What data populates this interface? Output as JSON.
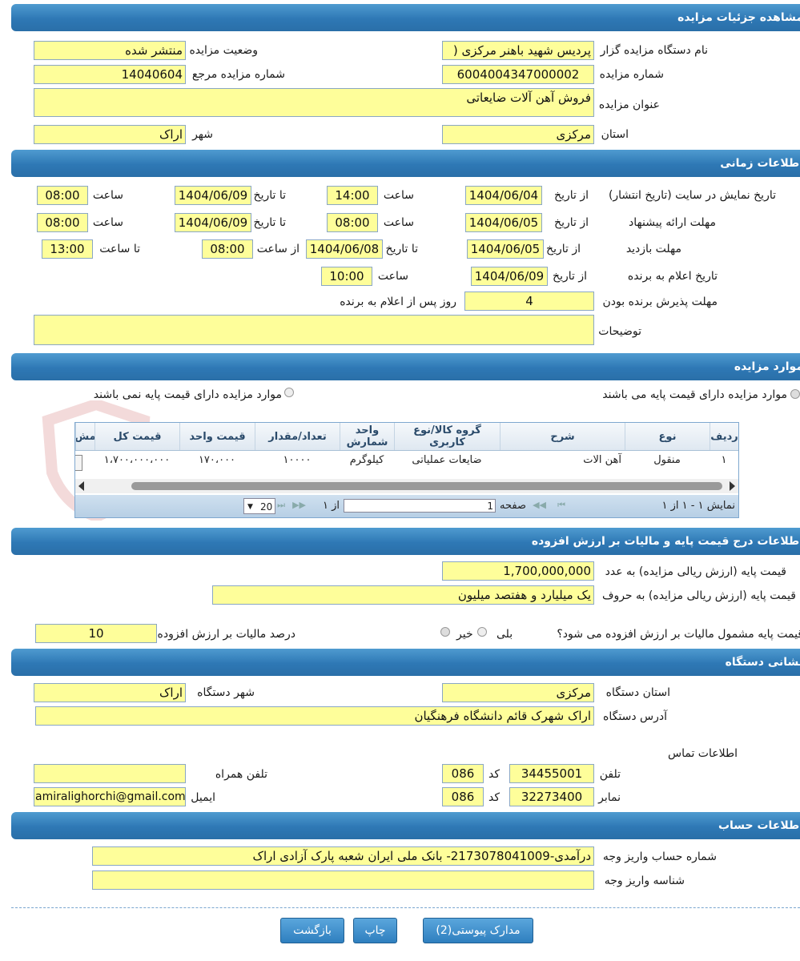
{
  "sections": {
    "details": "مشاهده جزئیات مزایده",
    "timing": "اطلاعات زمانی",
    "items": "موارد مزایده",
    "price": "اطلاعات درج قیمت پایه و مالیات بر ارزش افزوده",
    "address": "نشانی دستگاه",
    "account": "اطلاعات حساب"
  },
  "details": {
    "org_label": "نام دستگاه مزایده گزار",
    "org_value": "پردیس شهید باهنر مرکزی (",
    "status_label": "وضعیت مزایده",
    "status_value": "منتشر شده",
    "number_label": "شماره مزایده",
    "number_value": "6004004347000002",
    "ref_label": "شماره مزایده مرجع",
    "ref_value": "14040604",
    "title_label": "عنوان مزایده",
    "title_value": "فروش آهن آلات ضایعاتی",
    "province_label": "استان",
    "province_value": "مرکزی",
    "city_label": "شهر",
    "city_value": "اراک"
  },
  "timing": {
    "row1_label": "تاریخ نمایش در سایت (تاریخ انتشار)",
    "row2_label": "مهلت ارائه پیشنهاد",
    "row3_label": "مهلت بازدید",
    "row4_label": "تاریخ اعلام به برنده",
    "row5_label": "مهلت پذیرش برنده بودن",
    "from_date": "از تاریخ",
    "to_date": "تا تاریخ",
    "hour": "ساعت",
    "from_hour": "از ساعت",
    "to_hour": "تا ساعت",
    "r1_from": "1404/06/04",
    "r1_from_time": "14:00",
    "r1_to": "1404/06/09",
    "r1_to_time": "08:00",
    "r2_from": "1404/06/05",
    "r2_from_time": "08:00",
    "r2_to": "1404/06/09",
    "r2_to_time": "08:00",
    "r3_from": "1404/06/05",
    "r3_to": "1404/06/08",
    "r3_from_time": "08:00",
    "r3_to_time": "13:00",
    "r4_from": "1404/06/09",
    "r4_time": "10:00",
    "r5_days": "4",
    "r5_suffix": "روز پس از اعلام به برنده",
    "desc_label": "توضیحات"
  },
  "items": {
    "radio_with": "موارد مزایده دارای قیمت پایه می باشند",
    "radio_without": "موارد مزایده دارای قیمت پایه نمی باشند",
    "columns": [
      "ردیف",
      "نوع",
      "شرح",
      "گروه کالا/نوع کاربری",
      "واحد شمارش",
      "تعداد/مقدار",
      "قیمت واحد",
      "قیمت کل",
      "مش"
    ],
    "row": [
      "۱",
      "منقول",
      "آهن الات",
      "ضایعات عملیاتی",
      "کیلوگرم",
      "۱۰۰۰۰",
      "۱۷۰،۰۰۰",
      "۱،۷۰۰،۰۰۰،۰۰۰"
    ],
    "pager_show": "نمایش ۱ - ۱ از ۱",
    "pager_page": "صفحه",
    "pager_page_value": "1",
    "pager_of": "از ۱",
    "pager_size": "20"
  },
  "price": {
    "base_num_label": "قیمت پایه (ارزش ریالی مزایده) به عدد",
    "base_num_value": "1,700,000,000",
    "base_text_label": "قیمت پایه (ارزش ریالی مزایده) به حروف",
    "base_text_value": "یک میلیارد و هفتصد میلیون",
    "vat_q": "قیمت پایه مشمول مالیات بر ارزش افزوده می شود؟",
    "yes": "بلی",
    "no": "خیر",
    "vat_pct_label": "درصد مالیات بر ارزش افزوده",
    "vat_pct_value": "10"
  },
  "address": {
    "province_label": "استان دستگاه",
    "province_value": "مرکزی",
    "city_label": "شهر دستگاه",
    "city_value": "اراک",
    "addr_label": "آدرس دستگاه",
    "addr_value": "اراک شهرک قائم دانشگاه فرهنگیان",
    "contact_label": "اطلاعات تماس",
    "phone_label": "تلفن",
    "phone_value": "34455001",
    "code_label": "کد",
    "phone_code": "086",
    "mobile_label": "تلفن همراه",
    "mobile_value": "",
    "fax_label": "نمابر",
    "fax_value": "32273400",
    "fax_code": "086",
    "email_label": "ایمیل",
    "email_value": "amiralighorchi@gmail.com"
  },
  "account": {
    "acc_label": "شماره حساب واریز وجه",
    "acc_value": "درآمدی-2173078041009- بانک ملی ایران شعبه پارک آزادی اراک",
    "id_label": "شناسه واریز وجه",
    "id_value": ""
  },
  "buttons": {
    "docs": "مدارک پیوستی(2)",
    "print": "چاپ",
    "back": "بازگشت"
  }
}
